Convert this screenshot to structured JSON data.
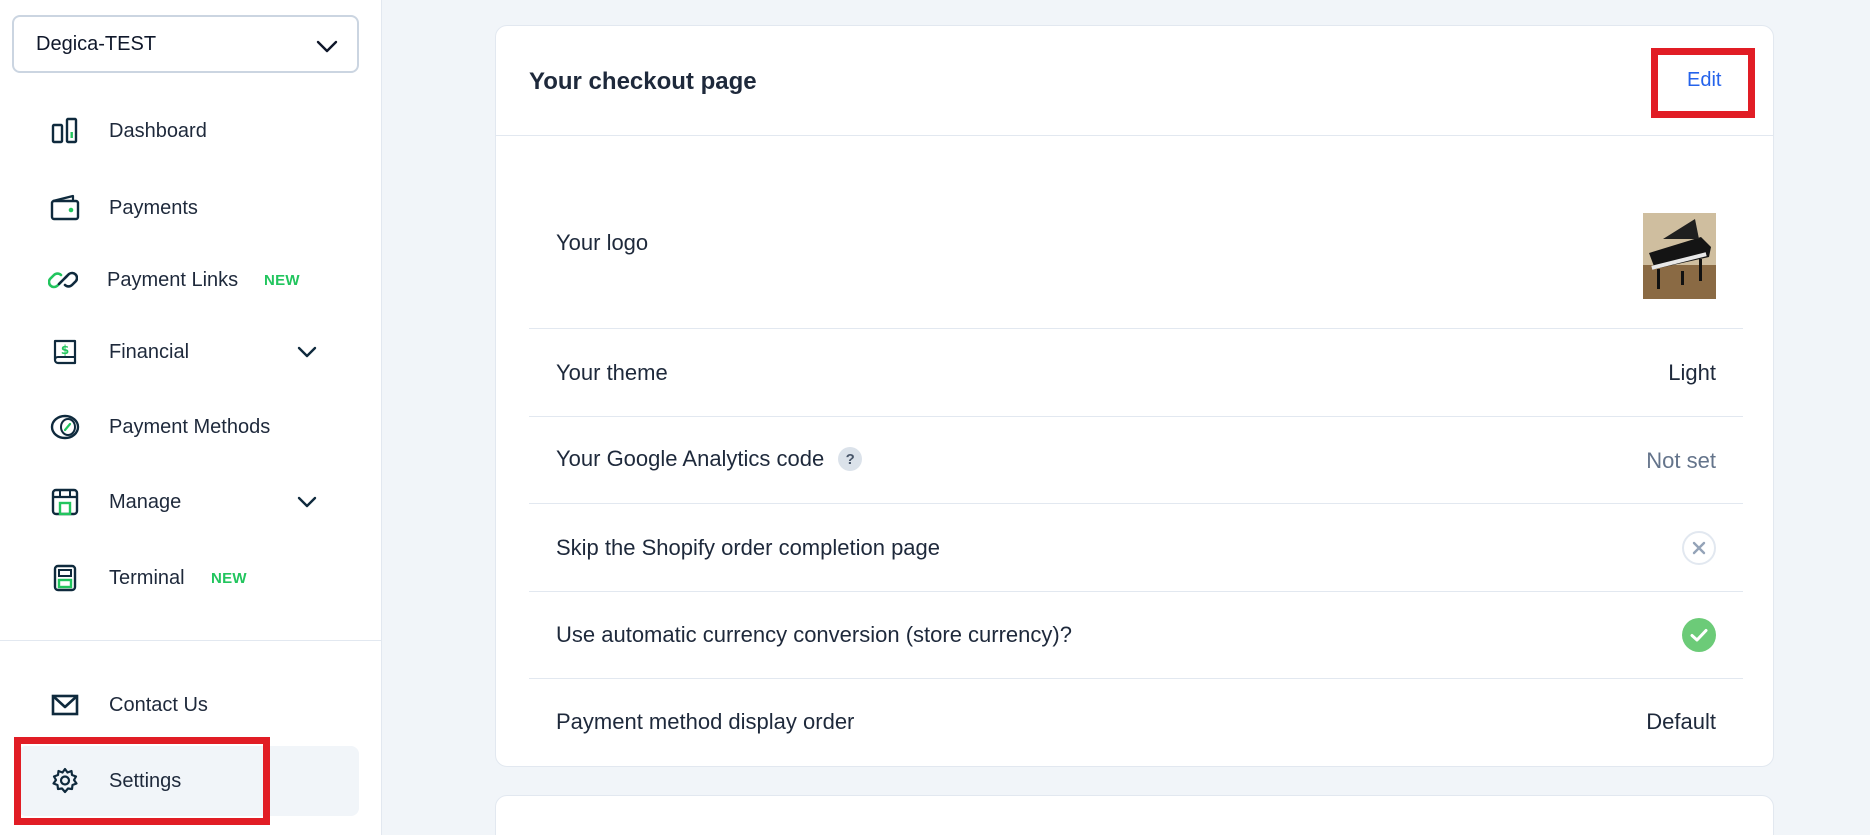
{
  "sidebar": {
    "store_name": "Degica-TEST",
    "items": [
      {
        "label": "Dashboard"
      },
      {
        "label": "Payments"
      },
      {
        "label": "Payment Links",
        "badge": "NEW"
      },
      {
        "label": "Financial"
      },
      {
        "label": "Payment Methods"
      },
      {
        "label": "Manage"
      },
      {
        "label": "Terminal",
        "badge": "NEW"
      },
      {
        "label": "Contact Us"
      },
      {
        "label": "Settings"
      }
    ]
  },
  "checkout": {
    "title": "Your checkout page",
    "edit_label": "Edit",
    "rows": [
      {
        "label": "Your logo"
      },
      {
        "label": "Your theme",
        "value": "Light"
      },
      {
        "label": "Your Google Analytics code",
        "help": "?",
        "value": "Not set"
      },
      {
        "label": "Skip the Shopify order completion page",
        "status": "off"
      },
      {
        "label": "Use automatic currency conversion (store currency)?",
        "status": "on"
      },
      {
        "label": "Payment method display order",
        "value": "Default"
      }
    ]
  },
  "colors": {
    "accent": "#2563eb",
    "new_badge": "#22c55e",
    "highlight": "#e11d25",
    "check": "#6ccb78",
    "icon_dark": "#0f2a3d",
    "icon_green": "#22c55e"
  }
}
